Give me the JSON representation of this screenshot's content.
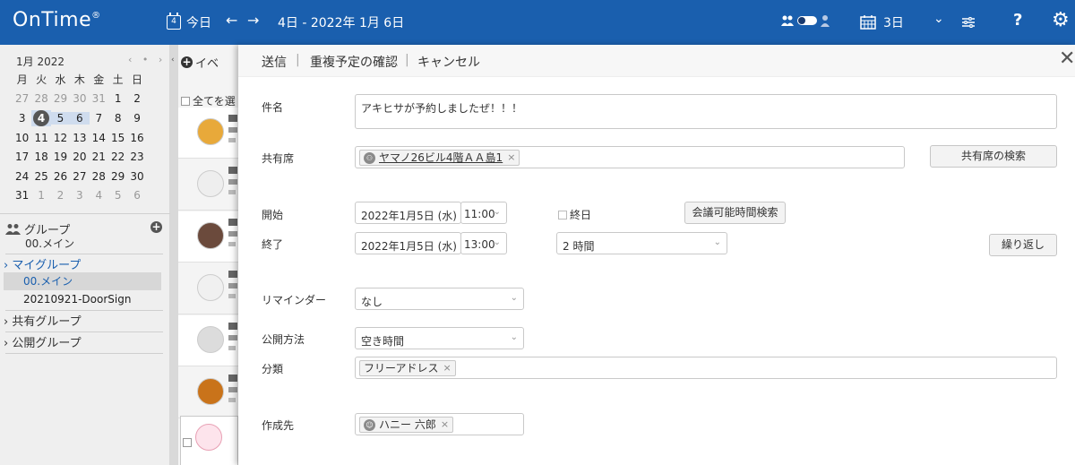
{
  "app": {
    "logo": "OnTime",
    "reg": "®"
  },
  "topbar": {
    "cal_icon_day": "4",
    "today": "今日",
    "prev": "←",
    "next": "→",
    "range": "4日 - 2022年 1月 6日",
    "view_days": "3日",
    "dropdown": "⌄",
    "help": "?",
    "settings": "⚙"
  },
  "mini_calendar": {
    "month": "1月 2022",
    "nav": "‹ • ›",
    "weekdays": [
      "月",
      "火",
      "水",
      "木",
      "金",
      "土",
      "日"
    ],
    "weeks": [
      [
        "27",
        "28",
        "29",
        "30",
        "31",
        "1",
        "2"
      ],
      [
        "3",
        "4",
        "5",
        "6",
        "7",
        "8",
        "9"
      ],
      [
        "10",
        "11",
        "12",
        "13",
        "14",
        "15",
        "16"
      ],
      [
        "17",
        "18",
        "19",
        "20",
        "21",
        "22",
        "23"
      ],
      [
        "24",
        "25",
        "26",
        "27",
        "28",
        "29",
        "30"
      ],
      [
        "31",
        "1",
        "2",
        "3",
        "4",
        "5",
        "6"
      ]
    ]
  },
  "groups": {
    "title": "グループ",
    "add": "+",
    "current": "00.メイン",
    "my_group": "マイグループ",
    "my_group_items": [
      "00.メイン",
      "20210921-DoorSign"
    ],
    "shared_group": "共有グループ",
    "public_group": "公開グループ"
  },
  "event_list": {
    "collapse": "‹",
    "header": "イベ",
    "select_all": "全てを選"
  },
  "form": {
    "actions": {
      "send": "送信",
      "check": "重複予定の確認",
      "cancel": "キャンセル",
      "sep": "|",
      "close": "✕"
    },
    "subject": {
      "label": "件名",
      "value": "アキヒサが予約しましたぜ！！！"
    },
    "resource": {
      "label": "共有席",
      "chip": "ヤマノ26ビル4階ＡＡ島1",
      "search_button": "共有席の検索"
    },
    "start": {
      "label": "開始",
      "date": "2022年1月5日 (水)",
      "time": "11:00"
    },
    "allday": "終日",
    "find_time_button": "会議可能時間検索",
    "end": {
      "label": "終了",
      "date": "2022年1月5日 (水)",
      "time": "13:00"
    },
    "duration": "2 時間",
    "repeat_button": "繰り返し",
    "reminder": {
      "label": "リマインダー",
      "value": "なし"
    },
    "visibility": {
      "label": "公開方法",
      "value": "空き時間"
    },
    "category": {
      "label": "分類",
      "chip": "フリーアドレス"
    },
    "creator": {
      "label": "作成先",
      "chip": "ハニー 六郎"
    },
    "chip_remove": "×"
  },
  "colors": {
    "topbar": "#1a5fae",
    "link_blue": "#1a5fae",
    "sidebar_bg": "#efefef"
  }
}
